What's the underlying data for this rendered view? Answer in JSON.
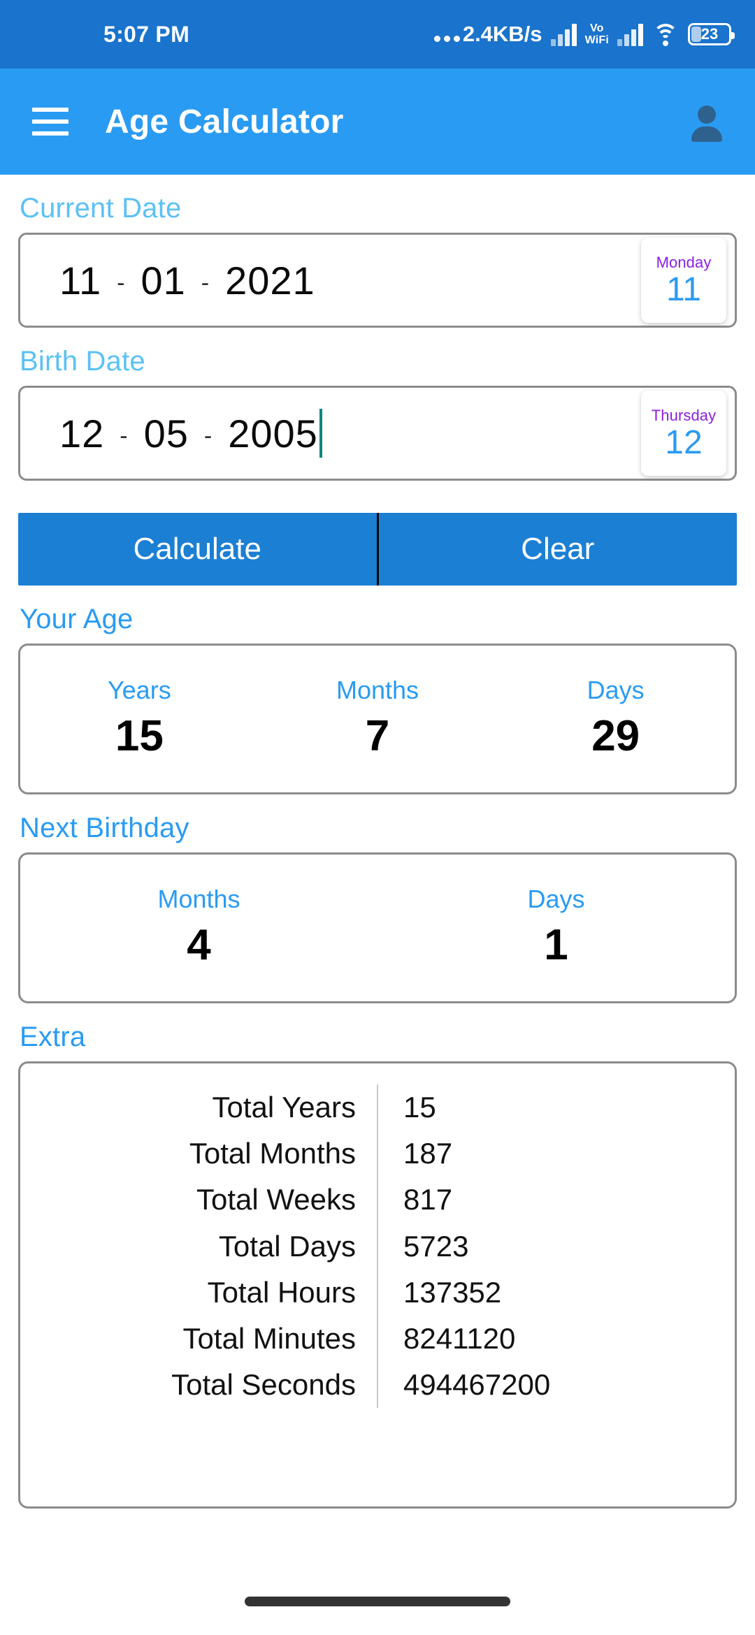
{
  "status_bar": {
    "time": "5:07 PM",
    "network_speed": "2.4KB/s",
    "volte_label_top": "Vo",
    "volte_label_bottom": "WiFi",
    "battery_level": "23",
    "icons": [
      "ellipsis-icon",
      "cellular-signal-icon",
      "vowifi-icon",
      "cellular-signal-icon",
      "wifi-icon",
      "battery-icon"
    ],
    "background_color": "#1A73CC"
  },
  "app_bar": {
    "title": "Age Calculator",
    "menu_icon": "hamburger-menu-icon",
    "account_icon": "account-person-icon",
    "background_color": "#2A9BF2"
  },
  "current_date": {
    "label": "Current Date",
    "day": "11",
    "month": "01",
    "year": "2021",
    "separator": "-",
    "day_card": {
      "weekday": "Monday",
      "day_number": "11"
    }
  },
  "birth_date": {
    "label": "Birth Date",
    "day": "12",
    "month": "05",
    "year": "2005",
    "separator": "-",
    "day_card": {
      "weekday": "Thursday",
      "day_number": "12"
    }
  },
  "actions": {
    "calculate_label": "Calculate",
    "clear_label": "Clear",
    "button_color": "#1B7FD4"
  },
  "your_age": {
    "label": "Your Age",
    "cells": [
      {
        "key": "Years",
        "value": "15"
      },
      {
        "key": "Months",
        "value": "7"
      },
      {
        "key": "Days",
        "value": "29"
      }
    ]
  },
  "next_birthday": {
    "label": "Next Birthday",
    "cells": [
      {
        "key": "Months",
        "value": "4"
      },
      {
        "key": "Days",
        "value": "1"
      }
    ]
  },
  "extra": {
    "label": "Extra",
    "rows": [
      {
        "key": "Total Years",
        "value": "15"
      },
      {
        "key": "Total Months",
        "value": "187"
      },
      {
        "key": "Total Weeks",
        "value": "817"
      },
      {
        "key": "Total Days",
        "value": "5723"
      },
      {
        "key": "Total Hours",
        "value": "137352"
      },
      {
        "key": "Total Minutes",
        "value": "8241120"
      },
      {
        "key": "Total Seconds",
        "value": "494467200"
      }
    ]
  },
  "colors": {
    "accent_blue": "#2A9BF2",
    "soft_blue": "#5BC1F5",
    "purple": "#8B20E0",
    "status_blue": "#1A73CC",
    "button_blue": "#1B7FD4"
  }
}
